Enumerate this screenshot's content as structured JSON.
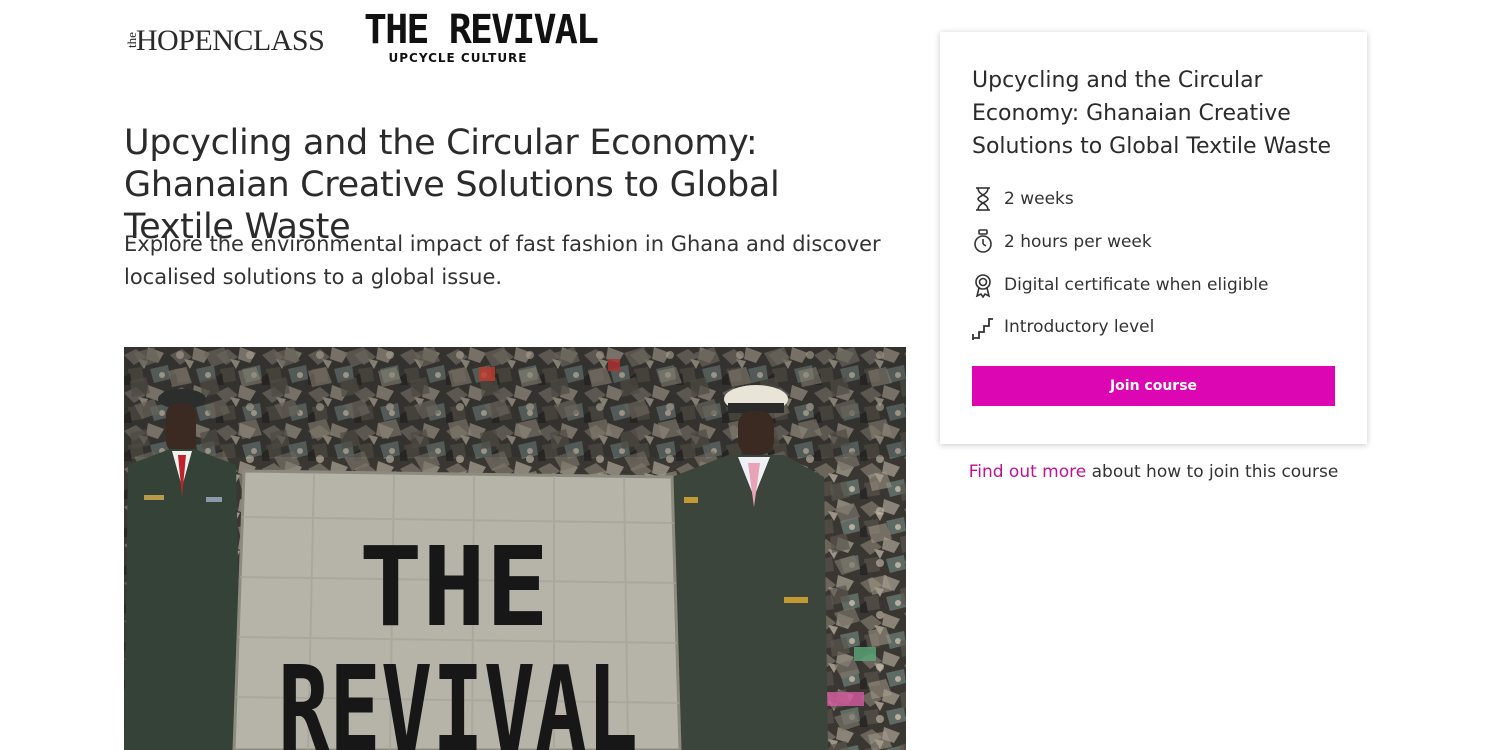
{
  "header": {
    "partner_logo_prefix": "the",
    "partner_logo_text": "HOPENCLASS",
    "course_logo_main": "THE REVIVAL",
    "course_logo_sub": "UPCYCLE CULTURE"
  },
  "main": {
    "title": "Upcycling and the Circular Economy: Ghanaian Creative Solutions to Global Textile Waste",
    "description": "Explore the environmental impact of fast fashion in Ghana and discover localised solutions to a global issue.",
    "hero_banner_text": [
      "THE",
      "REVIVAL"
    ]
  },
  "card": {
    "title": "Upcycling and the Circular Economy: Ghanaian Creative Solutions to Global Textile Waste",
    "facts": [
      {
        "icon": "hourglass-icon",
        "label": "2 weeks"
      },
      {
        "icon": "stopwatch-icon",
        "label": "2 hours per week"
      },
      {
        "icon": "certificate-icon",
        "label": "Digital certificate when eligible"
      },
      {
        "icon": "steps-icon",
        "label": "Introductory level"
      }
    ],
    "join_label": "Join course"
  },
  "footer_link": {
    "link_text": "Find out more",
    "rest_text": " about how to join this course"
  },
  "colors": {
    "accent": "#dc06b3",
    "link": "#c2118f"
  }
}
